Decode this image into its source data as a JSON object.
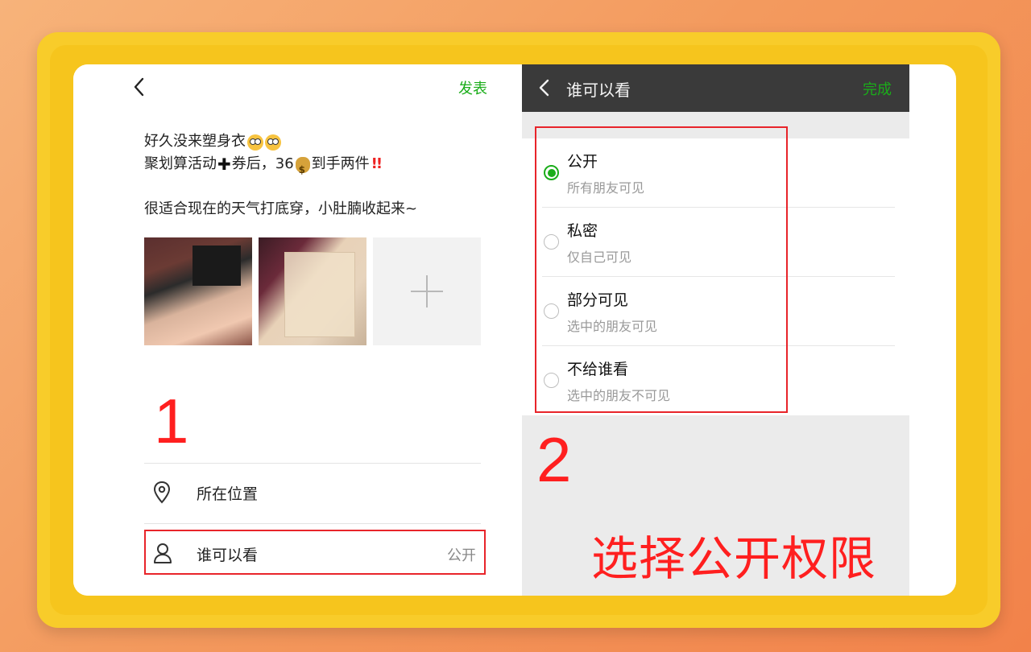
{
  "left_panel": {
    "publish_label": "发表",
    "post_lines": {
      "line1": "好久没来塑身衣",
      "line2_a": "聚划算活动",
      "line2_b": "券后，36",
      "line2_c": "到手两件",
      "line3": "很适合现在的天气打底穿，小肚腩收起来~"
    },
    "step_number": "1",
    "location_label": "所在位置",
    "who_can_see_label": "谁可以看",
    "who_can_see_value": "公开"
  },
  "right_panel": {
    "title": "谁可以看",
    "done_label": "完成",
    "options": [
      {
        "title": "公开",
        "subtitle": "所有朋友可见",
        "selected": true
      },
      {
        "title": "私密",
        "subtitle": "仅自己可见",
        "selected": false
      },
      {
        "title": "部分可见",
        "subtitle": "选中的朋友可见",
        "selected": false
      },
      {
        "title": "不给谁看",
        "subtitle": "选中的朋友不可见",
        "selected": false
      }
    ],
    "step_number": "2",
    "caption": "选择公开权限"
  },
  "colors": {
    "accent_green": "#1aad19",
    "annotation_red": "#e8242a",
    "frame_yellow": "#f8cc2a",
    "header_dark": "#3a3a3a"
  },
  "icons": [
    "back-chevron-icon",
    "location-pin-icon",
    "person-icon",
    "add-photo-plus-icon",
    "radio-icon"
  ]
}
